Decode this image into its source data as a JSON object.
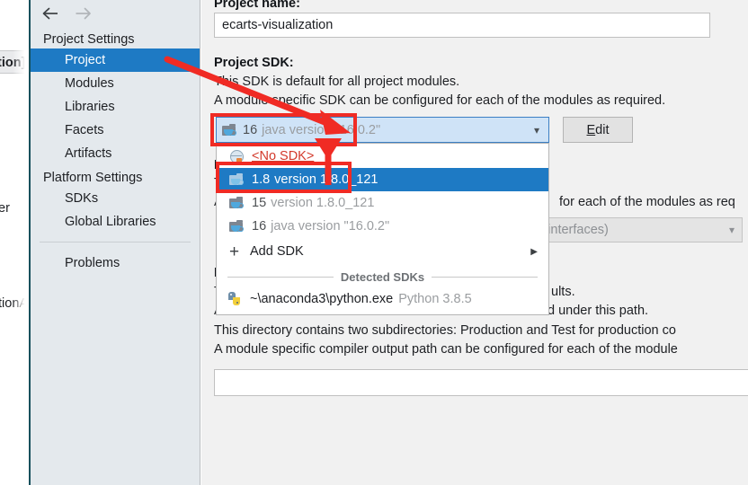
{
  "window": {
    "left_fragments": {
      "tab_fragment": "tion]",
      "frag2": "er",
      "frag3": "tionA"
    },
    "nav": {
      "back_icon": "arrow-left-icon",
      "forward_icon": "arrow-right-icon"
    }
  },
  "sidebar": {
    "groups": [
      {
        "title": "Project Settings",
        "items": [
          {
            "label": "Project",
            "selected": true
          },
          {
            "label": "Modules",
            "selected": false
          },
          {
            "label": "Libraries",
            "selected": false
          },
          {
            "label": "Facets",
            "selected": false
          },
          {
            "label": "Artifacts",
            "selected": false
          }
        ]
      },
      {
        "title": "Platform Settings",
        "items": [
          {
            "label": "SDKs",
            "selected": false
          },
          {
            "label": "Global Libraries",
            "selected": false
          }
        ]
      }
    ],
    "footer_item": "Problems"
  },
  "main": {
    "project_name": {
      "label": "Project name:",
      "value": "ecarts-visualization"
    },
    "project_sdk": {
      "label": "Project SDK:",
      "desc_line1": "This SDK is default for all project modules.",
      "desc_line2": "A module specific SDK can be configured for each of the modules as required.",
      "combo_icon": "jdk-folder-icon",
      "combo_version": "16",
      "combo_detail": "java version \"16.0.2\"",
      "combo_chevron": "chevron-down-icon",
      "edit_button_mnemonic": "E",
      "edit_button_rest": "dit"
    },
    "language_level": {
      "visible_text": "nd interfaces)",
      "chevron": "chevron-down-icon"
    },
    "behind_popup": {
      "sdk_desc_tail": "for each of the modules as req",
      "compiler_line_a_head": "T",
      "compiler_line_b_head": "A",
      "compiler_tail_1": "ults.",
      "compiler_tail_2": "d under this path.",
      "bold_head_1": "P",
      "bold_head_2": "P"
    },
    "compiler_output": {
      "line1": "This directory contains two subdirectories: Production and Test for production co",
      "line2": "A module specific compiler output path can be configured for each of the module",
      "field_value": ""
    }
  },
  "sdk_dropdown": {
    "options": [
      {
        "kind": "no-sdk",
        "icon": "no-sdk-icon",
        "label": "<No SDK>",
        "version": "",
        "detail": "",
        "selected": false
      },
      {
        "kind": "jdk",
        "icon": "jdk-folder-icon",
        "label": "",
        "version": "1.8",
        "detail": "version 1.8.0_121",
        "selected": true
      },
      {
        "kind": "jdk",
        "icon": "jdk-folder-icon",
        "label": "",
        "version": "15",
        "detail": "version 1.8.0_121",
        "selected": false
      },
      {
        "kind": "jdk",
        "icon": "jdk-folder-icon",
        "label": "",
        "version": "16",
        "detail": "java version \"16.0.2\"",
        "selected": false
      }
    ],
    "add_sdk": {
      "icon": "plus-icon",
      "label": "Add SDK",
      "submenu_arrow": "triangle-right-icon"
    },
    "detected_caption": "Detected SDKs",
    "detected_items": [
      {
        "icon": "python-icon",
        "label": "~\\anaconda3\\python.exe",
        "detail": "Python 3.8.5"
      }
    ]
  },
  "annotations": {
    "accent_red": "#f02b24",
    "selection_blue": "#1e7ac4",
    "arrow_to_combo": "red-arrow-icon",
    "arrow_to_option": "red-arrow-up-icon",
    "box_combo": "red-highlight-box",
    "box_option": "red-highlight-box"
  }
}
